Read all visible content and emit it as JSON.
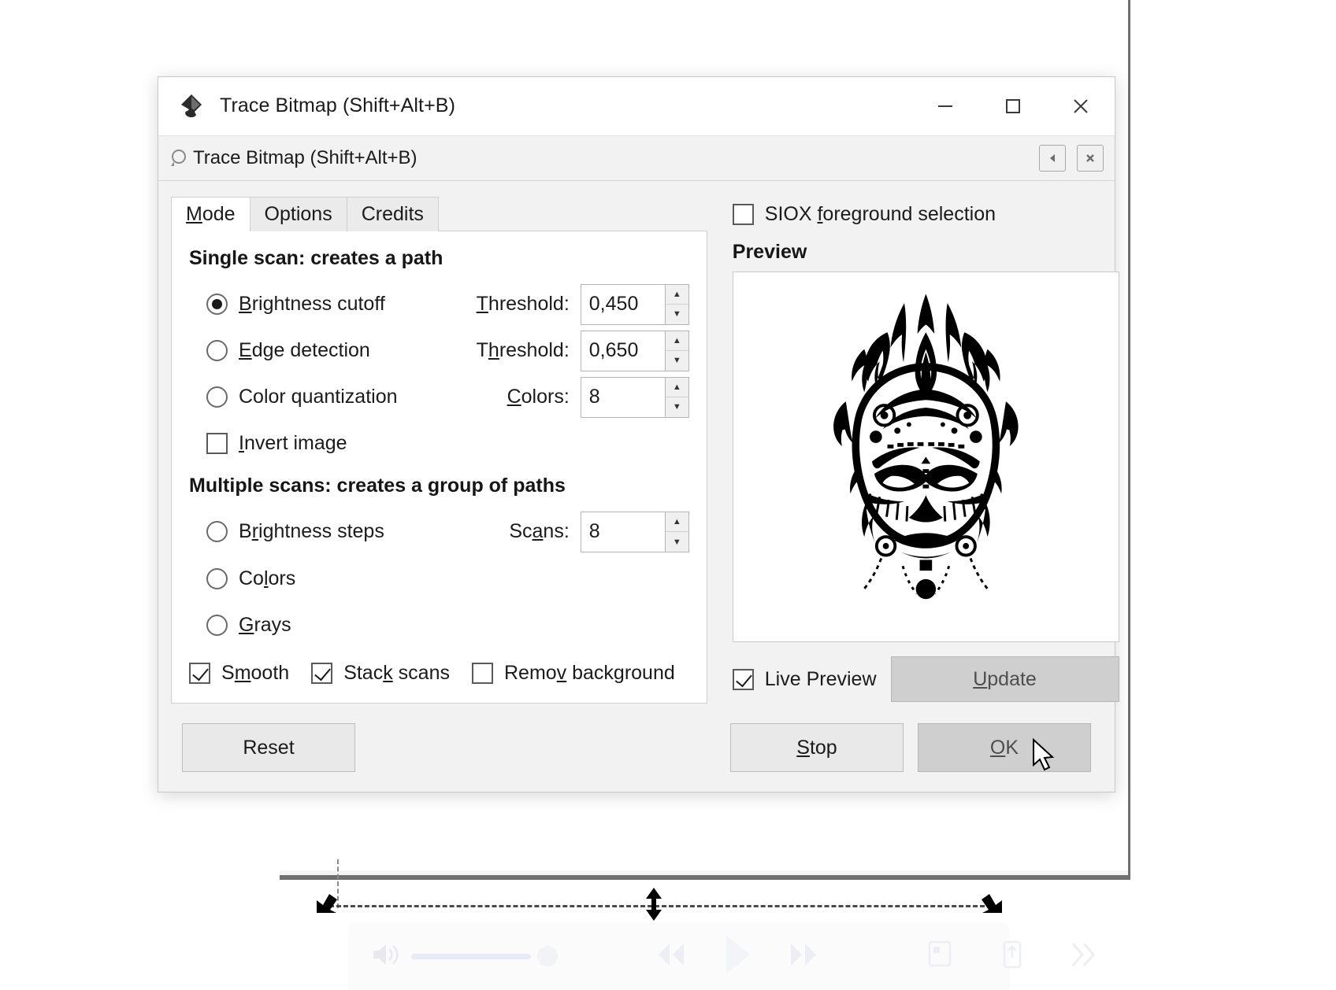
{
  "window": {
    "title": "Trace Bitmap (Shift+Alt+B)",
    "app_icon": "inkscape-logo-icon",
    "minimize_label": "—",
    "maximize_label": "□",
    "close_label": "✕"
  },
  "dockbar": {
    "title": "Trace Bitmap (Shift+Alt+B)",
    "icon": "dialog-dock-icon",
    "undock_label": "◀",
    "close_label": "✖"
  },
  "tabs": [
    {
      "label": "Mode",
      "accel": "M",
      "active": true
    },
    {
      "label": "Options",
      "accel": "O",
      "active": false
    },
    {
      "label": "Credits",
      "accel": "C",
      "active": false
    }
  ],
  "single_scan": {
    "heading": "Single scan: creates a path",
    "options": [
      {
        "label": "Brightness cutoff",
        "accel": "B",
        "selected": true,
        "field_label": "Threshold:",
        "field_accel": "T",
        "value": "0,450"
      },
      {
        "label": "Edge detection",
        "accel": "E",
        "selected": false,
        "field_label": "Threshold:",
        "field_accel": "h",
        "value": "0,650"
      },
      {
        "label": "Color quantization",
        "accel": "q",
        "selected": false,
        "field_label": "Colors:",
        "field_accel": "C",
        "value": "8"
      }
    ],
    "invert": {
      "label": "Invert image",
      "accel": "I",
      "checked": false
    }
  },
  "multiple_scans": {
    "heading": "Multiple scans: creates a group of paths",
    "options": [
      {
        "label": "Brightness steps",
        "accel": "r",
        "selected": false,
        "field_label": "Scans:",
        "field_accel": "a",
        "value": "8"
      },
      {
        "label": "Colors",
        "accel": "l",
        "selected": false
      },
      {
        "label": "Grays",
        "accel": "G",
        "selected": false
      }
    ],
    "checks": [
      {
        "label": "Smooth",
        "accel": "m",
        "checked": true
      },
      {
        "label": "Stack scans",
        "accel": "k",
        "checked": true
      },
      {
        "label": "Remove background",
        "accel": "v",
        "checked": false
      }
    ]
  },
  "preview_panel": {
    "siox": {
      "label": "SIOX foreground selection",
      "accel": "f",
      "checked": false
    },
    "title": "Preview",
    "image_name": "traced-tribal-mask-preview",
    "live_preview": {
      "label": "Live Preview",
      "checked": true
    },
    "update_button": "Update",
    "update_accel": "U"
  },
  "footer": {
    "reset": "Reset",
    "stop": "Stop",
    "stop_accel": "S",
    "ok": "OK",
    "ok_accel": "O"
  },
  "background": {
    "media": {
      "volume_icon": "volume-icon",
      "rewind_icon": "rewind-icon",
      "play_icon": "play-icon",
      "forward_icon": "fast-forward-icon",
      "screen_icon": "screen-share-icon",
      "upload_icon": "upload-icon",
      "next_icon": "next-icon"
    }
  },
  "colors": {
    "dialog_bg": "#f2f2f2",
    "panel_bg": "#ffffff",
    "border": "#cfcfcf",
    "text": "#1b1b1b",
    "button_bg": "#e9e9e9",
    "button_pressed": "#cfcfcf"
  }
}
